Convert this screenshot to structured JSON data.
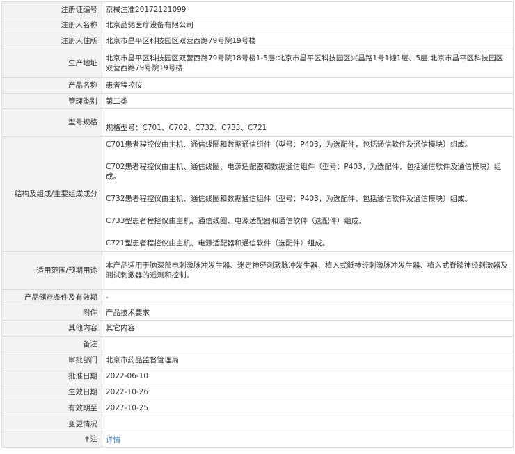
{
  "rows": {
    "reg_no": {
      "label": "注册证编号",
      "value": "京械注准20172121099"
    },
    "registrant": {
      "label": "注册人名称",
      "value": "北京品驰医疗设备有限公司"
    },
    "residence": {
      "label": "注册人住所",
      "value": "北京市昌平区科技园区双营西路79号院19号楼"
    },
    "production": {
      "label": "生产地址",
      "value": "北京市昌平区科技园区双营西路79号院18号楼1-5层;北京市昌平区科技园区兴昌路1号1幢1层、5层;北京市昌平区科技园区双营西路79号院19号楼"
    },
    "product": {
      "label": "产品名称",
      "value": "患者程控仪"
    },
    "category": {
      "label": "管理类别",
      "value": "第二类"
    },
    "model": {
      "label": "型号规格",
      "value": "规格型号：C701、C702、C732、C733、C721"
    },
    "structure": {
      "label": "结构及组成/主要组成成分",
      "paragraphs": [
        "C701患者程控仪由主机、通信线圈和数据通信组件（型号：P403，为选配件，包括通信软件及通信模块）组成。",
        "C702患者程控仪由主机、通信线圈、电源适配器和数据通信组件（型号：P403，为选配件，包括通信软件及通信模块）组成。",
        "C732患者程控仪由主机、通信线圈和数据通信组件（型号：P403，为选配件，包括通信软件及通信模块）组成。",
        "C733型患者程控仪由主机、通信线圈、电源适配器和通信软件（选配件）组成。",
        "C721型患者程控仪由主机、电源适配器和通信软件（选配件）组成。"
      ]
    },
    "scope": {
      "label": "适用范围/预期用途",
      "value": "本产品适用于脑深部电刺激脉冲发生器、迷走神经刺激脉冲发生器、植入式骶神经刺激脉冲发生器、植入式脊髓神经刺激器及测试刺激器的遥测和控制。"
    },
    "storage": {
      "label": "产品储存条件及有效期",
      "value": "-"
    },
    "attachment": {
      "label": "附件",
      "value": "产品技术要求"
    },
    "other": {
      "label": "其他内容",
      "value": "其它内容"
    },
    "remark": {
      "label": "备注",
      "value": ""
    },
    "authority": {
      "label": "审批部门",
      "value": "北京市药品监督管理局"
    },
    "approval": {
      "label": "批准日期",
      "value": "2022-06-10"
    },
    "effective": {
      "label": "生效日期",
      "value": "2022-10-26"
    },
    "expiry": {
      "label": "有效期至",
      "value": "2027-10-25"
    },
    "changes": {
      "label": "变更情况",
      "value": ""
    },
    "note": {
      "label": "注",
      "icon": "pin-icon",
      "link": "详情"
    }
  },
  "colors": {
    "label_bg": "#f3f3f3",
    "border": "#dcdcdc",
    "text": "#333333",
    "link": "#3b7bbf"
  }
}
